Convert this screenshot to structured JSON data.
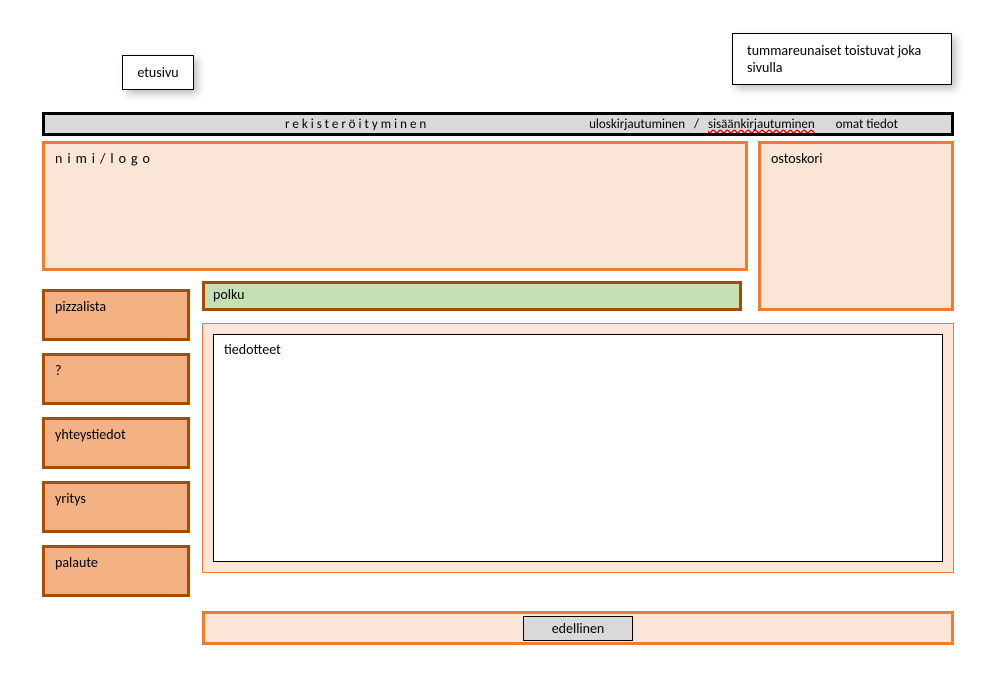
{
  "callouts": {
    "left": "etusivu",
    "right": "tummareunaiset toistuvat joka sivulla"
  },
  "topnav": {
    "register": "rekisteröityminen",
    "logout": "uloskirjautuminen",
    "sep": " / ",
    "login": "sisäänkirjautuminen",
    "own": "omat tiedot"
  },
  "logo": "nimi/logo",
  "cart": "ostoskori",
  "sidemenu": [
    "pizzalista",
    "?",
    "yhteystiedot",
    "yritys",
    "palaute"
  ],
  "breadcrumb": "polku",
  "content_title": "tiedotteet",
  "footer_button": "edellinen"
}
